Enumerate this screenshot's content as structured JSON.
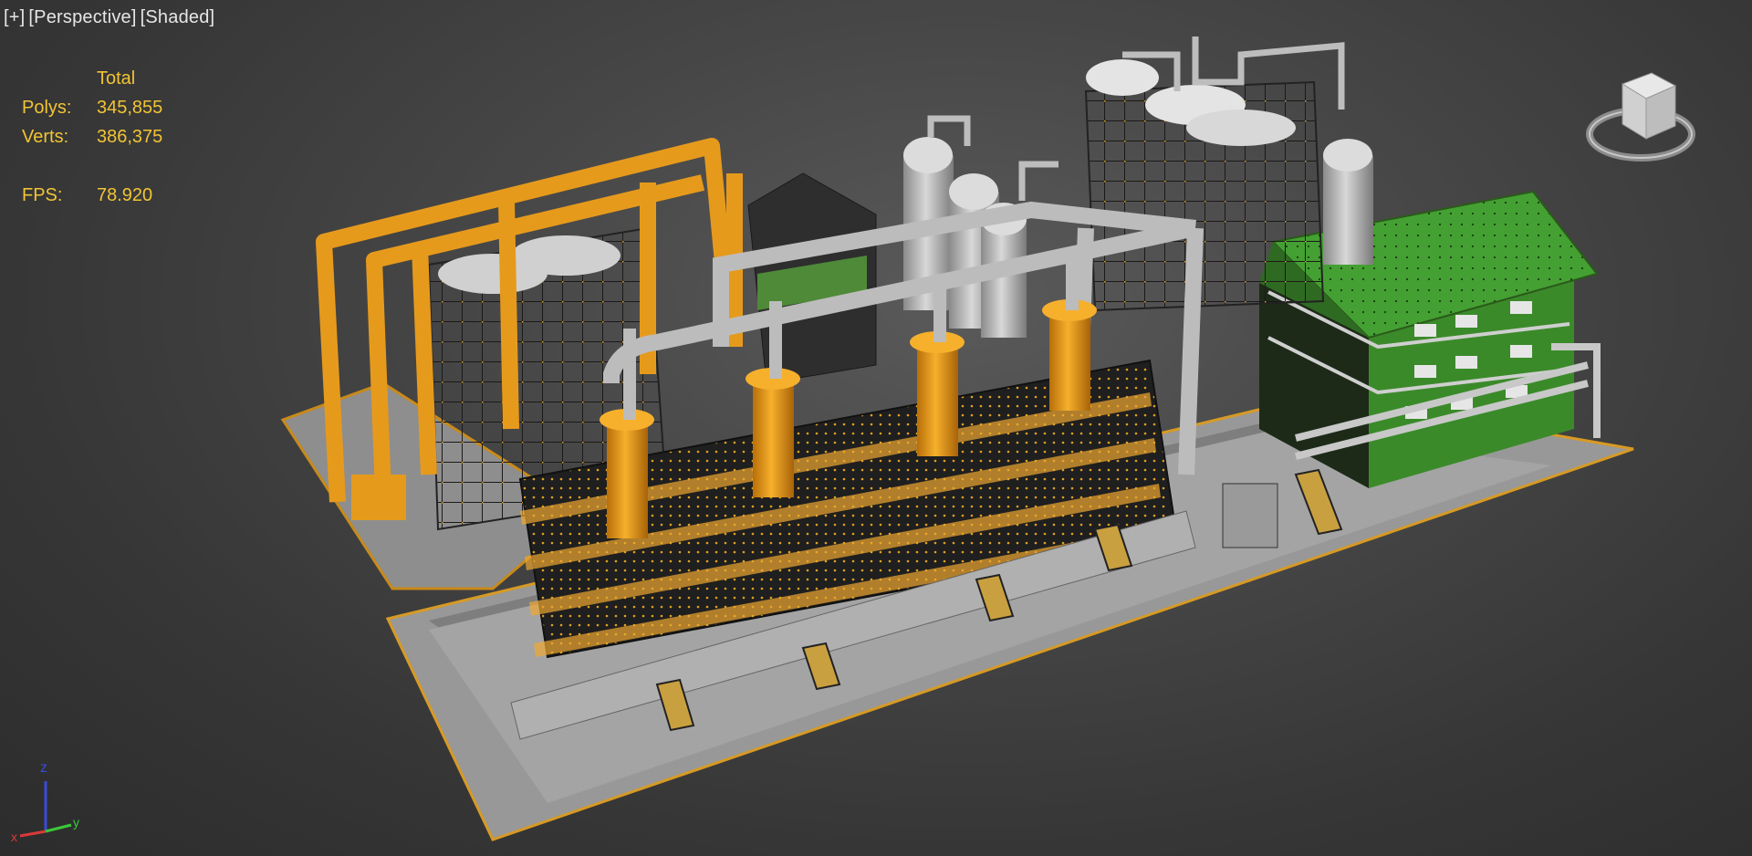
{
  "viewport": {
    "labels": [
      "[+]",
      "[Perspective]",
      "[Shaded]"
    ]
  },
  "stats": {
    "header": "Total",
    "polys_label": "Polys:",
    "polys_value": "345,855",
    "verts_label": "Verts:",
    "verts_value": "386,375",
    "fps_label": "FPS:",
    "fps_value": "78.920"
  },
  "axis": {
    "z": "z",
    "x": "x",
    "y": "y"
  },
  "colors": {
    "stats_text": "#f2c434",
    "label_text": "#e6e6e6",
    "accent_orange": "#e69a1c",
    "building_green": "#3c8c28",
    "concrete": "#9c9c9c"
  }
}
